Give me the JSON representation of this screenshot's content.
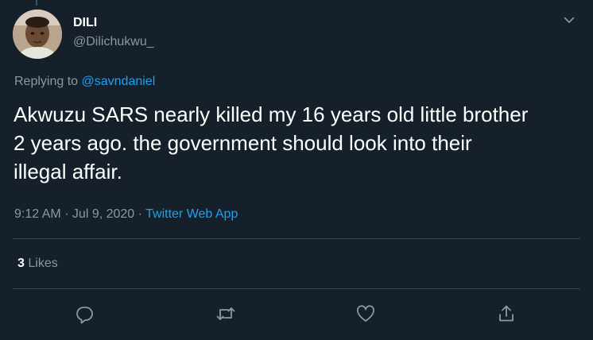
{
  "author": {
    "display_name": "DILI",
    "handle": "@Dilichukwu_"
  },
  "reply_context": {
    "prefix": "Replying to ",
    "mention": "@savndaniel"
  },
  "tweet": {
    "text": "Akwuzu SARS nearly killed my 16 years old little brother\n2 years ago. the government should look into their\nillegal affair.",
    "timestamp": "9:12 AM · Jul 9, 2020",
    "separator": " · ",
    "source": "Twitter Web App"
  },
  "stats": {
    "likes_count": "3",
    "likes_label": "Likes"
  },
  "icons": {
    "menu": "chevron-down-icon",
    "reply": "reply-icon",
    "retweet": "retweet-icon",
    "like": "heart-icon",
    "share": "share-icon"
  },
  "colors": {
    "background": "#15202b",
    "text_primary": "#ffffff",
    "text_secondary": "#8899a6",
    "accent": "#1da1f2",
    "divider": "#38444d"
  }
}
